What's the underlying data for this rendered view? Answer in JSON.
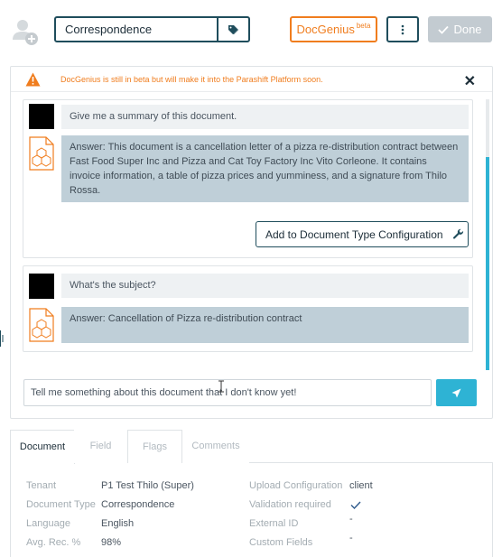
{
  "header": {
    "document_type": "Correspondence",
    "docgenius_label": "DocGenius",
    "docgenius_badge": "beta",
    "done_label": "Done"
  },
  "notice": {
    "text": "DocGenius is still in beta but will make it into the Parashift Platform soon."
  },
  "chat": [
    {
      "question": "Give me a summary of this document.",
      "answer": "Answer: This document is a cancellation letter of a pizza re-distribution contract between Fast Food Super Inc and Pizza and Cat Toy Factory Inc Vito Corleone. It contains invoice information, a table of pizza prices and yumminess, and a signature from Thilo Rossa.",
      "action_label": "Add to Document Type Configuration"
    },
    {
      "question": "What's the subject?",
      "answer": "Answer: Cancellation of Pizza re-distribution contract"
    }
  ],
  "input": {
    "value": "Tell me something about this document that I don't know yet!"
  },
  "tabs": [
    "Document",
    "Field",
    "Flags",
    "Comments"
  ],
  "properties": {
    "left": [
      {
        "label": "Tenant",
        "value": "P1 Test Thilo (Super)"
      },
      {
        "label": "Document Type",
        "value": "Correspondence"
      },
      {
        "label": "Language",
        "value": "English"
      },
      {
        "label": "Avg. Rec. %",
        "value": "98%"
      }
    ],
    "right": [
      {
        "label": "Upload Configuration",
        "value": "client"
      },
      {
        "label": "Validation required",
        "value": ""
      },
      {
        "label": "External ID",
        "value": "-"
      },
      {
        "label": "Custom Fields",
        "value": "-"
      }
    ]
  },
  "colors": {
    "accent": "#2eb3d4",
    "brand_orange": "#f07d1e",
    "dark": "#1f4d5c",
    "answer_bg": "#bfcfd8"
  }
}
